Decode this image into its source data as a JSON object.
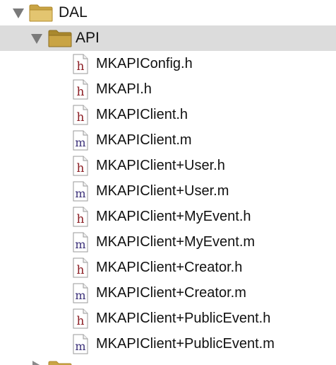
{
  "navigator": {
    "dal_folder": {
      "name": "DAL",
      "icon": "folder-icon",
      "expanded": true
    },
    "api_folder": {
      "name": "API",
      "icon": "folder-icon",
      "expanded": true,
      "selected": true
    },
    "files": [
      {
        "name": "MKAPIConfig.h",
        "type": "h"
      },
      {
        "name": "MKAPI.h",
        "type": "h"
      },
      {
        "name": "MKAPIClient.h",
        "type": "h"
      },
      {
        "name": "MKAPIClient.m",
        "type": "m"
      },
      {
        "name": "MKAPIClient+User.h",
        "type": "h"
      },
      {
        "name": "MKAPIClient+User.m",
        "type": "m"
      },
      {
        "name": "MKAPIClient+MyEvent.h",
        "type": "h"
      },
      {
        "name": "MKAPIClient+MyEvent.m",
        "type": "m"
      },
      {
        "name": "MKAPIClient+Creator.h",
        "type": "h"
      },
      {
        "name": "MKAPIClient+Creator.m",
        "type": "m"
      },
      {
        "name": "MKAPIClient+PublicEvent.h",
        "type": "h"
      },
      {
        "name": "MKAPIClient+PublicEvent.m",
        "type": "m"
      }
    ]
  },
  "colors": {
    "selection": "#dcdcdc",
    "folder": "#d9b65a",
    "header_file_letter": "#8b1c22",
    "impl_file_letter": "#3a2f78"
  }
}
